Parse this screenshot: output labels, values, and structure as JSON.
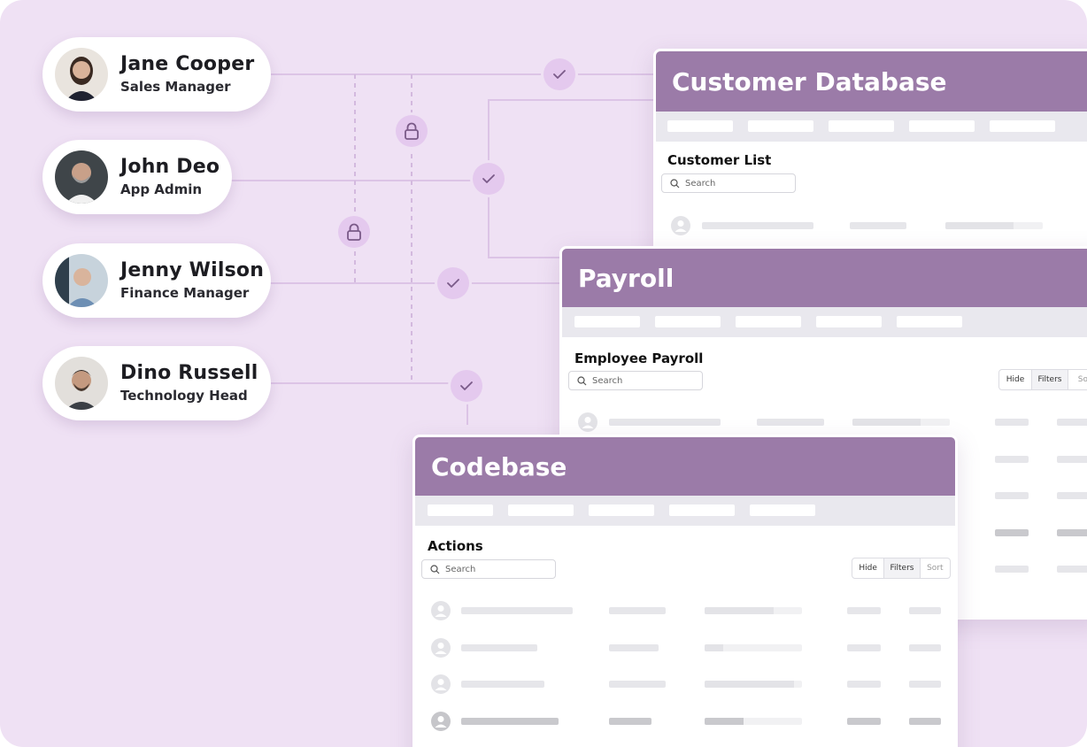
{
  "users": [
    {
      "name": "Jane Cooper",
      "role": "Sales Manager"
    },
    {
      "name": "John Deo",
      "role": "App Admin"
    },
    {
      "name": "Jenny Wilson",
      "role": "Finance Manager"
    },
    {
      "name": "Dino Russell",
      "role": "Technology Head"
    }
  ],
  "badge_icons": [
    "check-icon",
    "lock-icon"
  ],
  "colors": {
    "background": "#efe1f4",
    "header": "#9b7ba8",
    "connector": "#dcc4e6",
    "badge": "#e4c9ee"
  },
  "windows": {
    "customer_database": {
      "title": "Customer Database",
      "section": "Customer List",
      "search_placeholder": "Search"
    },
    "payroll": {
      "title": "Payroll",
      "section": "Employee Payroll",
      "search_placeholder": "Search",
      "buttons": {
        "hide": "Hide",
        "filters": "Filters",
        "sort": "Sort"
      }
    },
    "codebase": {
      "title": "Codebase",
      "section": "Actions",
      "search_placeholder": "Search",
      "buttons": {
        "hide": "Hide",
        "filters": "Filters",
        "sort": "Sort"
      }
    }
  }
}
